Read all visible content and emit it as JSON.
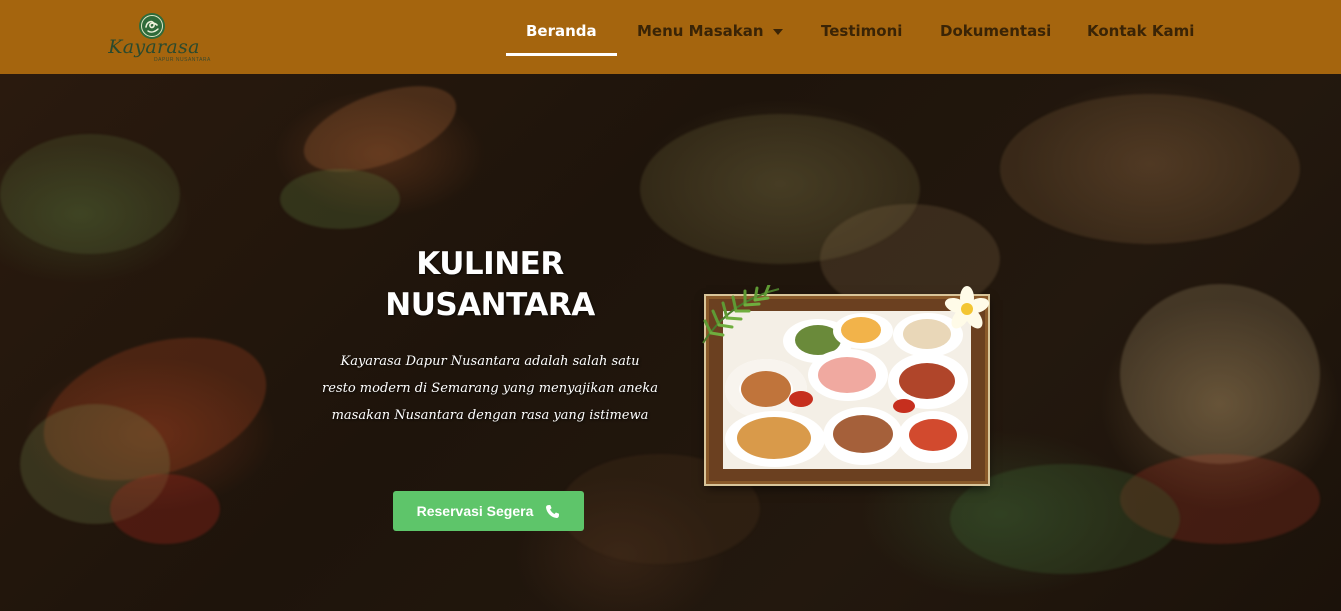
{
  "brand": {
    "name": "Kayarasa",
    "tagline": "DAPUR NUSANTARA"
  },
  "nav": {
    "items": [
      {
        "label": "Beranda",
        "active": true
      },
      {
        "label": "Menu Masakan",
        "has_dropdown": true
      },
      {
        "label": "Testimoni"
      },
      {
        "label": "Dokumentasi"
      },
      {
        "label": "Kontak Kami"
      }
    ]
  },
  "hero": {
    "title_line1": "KULINER",
    "title_line2": "NUSANTARA",
    "description": "Kayarasa Dapur Nusantara adalah salah satu resto modern di Semarang yang menyajikan aneka masakan Nusantara dengan rasa yang istimewa",
    "cta_label": "Reservasi Segera"
  },
  "colors": {
    "navbar": "#a5650e",
    "nav_text": "#3a2406",
    "nav_active": "#ffffff",
    "cta": "#5ec56a"
  },
  "icons": {
    "logo": "kayarasa-logo-icon",
    "dropdown": "chevron-down-icon",
    "cta": "phone-icon"
  }
}
